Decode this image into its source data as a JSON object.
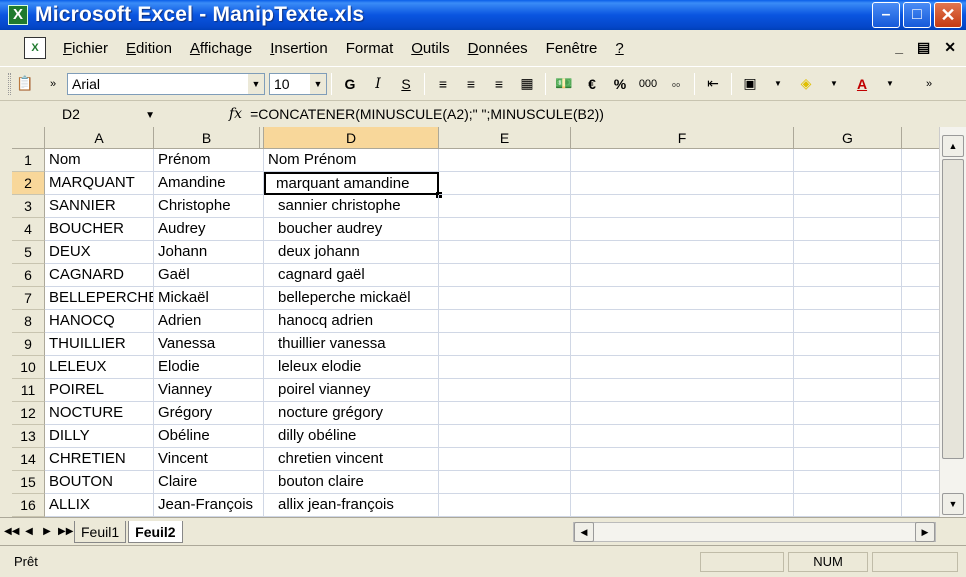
{
  "window": {
    "title": "Microsoft Excel - ManipTexte.xls"
  },
  "menu": [
    "Fichier",
    "Edition",
    "Affichage",
    "Insertion",
    "Format",
    "Outils",
    "Données",
    "Fenêtre",
    "?"
  ],
  "menu_underline": [
    "F",
    "E",
    "A",
    "I",
    "",
    "O",
    "D",
    "",
    "?"
  ],
  "toolbar": {
    "font": "Arial",
    "size": "10",
    "bold": "G",
    "italic": "I",
    "underline": "S",
    "euro": "€",
    "percent": "%",
    "thousands": "000"
  },
  "formula_bar": {
    "cell_ref": "D2",
    "fx": "fx",
    "formula": "=CONCATENER(MINUSCULE(A2);\" \";MINUSCULE(B2))"
  },
  "grid": {
    "columns": [
      "A",
      "B",
      "C",
      "D",
      "E",
      "F",
      "G"
    ],
    "rows": [
      "1",
      "2",
      "3",
      "4",
      "5",
      "6",
      "7",
      "8",
      "9",
      "10",
      "11",
      "12",
      "13",
      "14",
      "15",
      "16",
      "17"
    ],
    "cells": [
      [
        "Nom",
        "Prénom",
        "Nom Prénom"
      ],
      [
        "MARQUANT",
        "Amandine",
        "marquant amandine"
      ],
      [
        "SANNIER",
        "Christophe",
        "sannier christophe"
      ],
      [
        "BOUCHER",
        "Audrey",
        "boucher audrey"
      ],
      [
        "DEUX",
        "Johann",
        "deux johann"
      ],
      [
        "CAGNARD",
        "Gaël",
        "cagnard gaël"
      ],
      [
        "BELLEPERCHE",
        "Mickaël",
        "belleperche mickaël"
      ],
      [
        "HANOCQ",
        "Adrien",
        "hanocq adrien"
      ],
      [
        "THUILLIER",
        "Vanessa",
        "thuillier vanessa"
      ],
      [
        "LELEUX",
        "Elodie",
        "leleux elodie"
      ],
      [
        "POIREL",
        "Vianney",
        "poirel vianney"
      ],
      [
        "NOCTURE",
        "Grégory",
        "nocture grégory"
      ],
      [
        "DILLY",
        "Obéline",
        "dilly obéline"
      ],
      [
        "CHRETIEN",
        "Vincent",
        "chretien vincent"
      ],
      [
        "BOUTON",
        "Claire",
        "bouton claire"
      ],
      [
        "ALLIX",
        "Jean-François",
        "allix jean-françois"
      ]
    ],
    "active_cell": "D2"
  },
  "sheets": [
    {
      "name": "Feuil1",
      "active": false
    },
    {
      "name": "Feuil2",
      "active": true
    }
  ],
  "status": {
    "left": "Prêt",
    "num": "NUM"
  }
}
